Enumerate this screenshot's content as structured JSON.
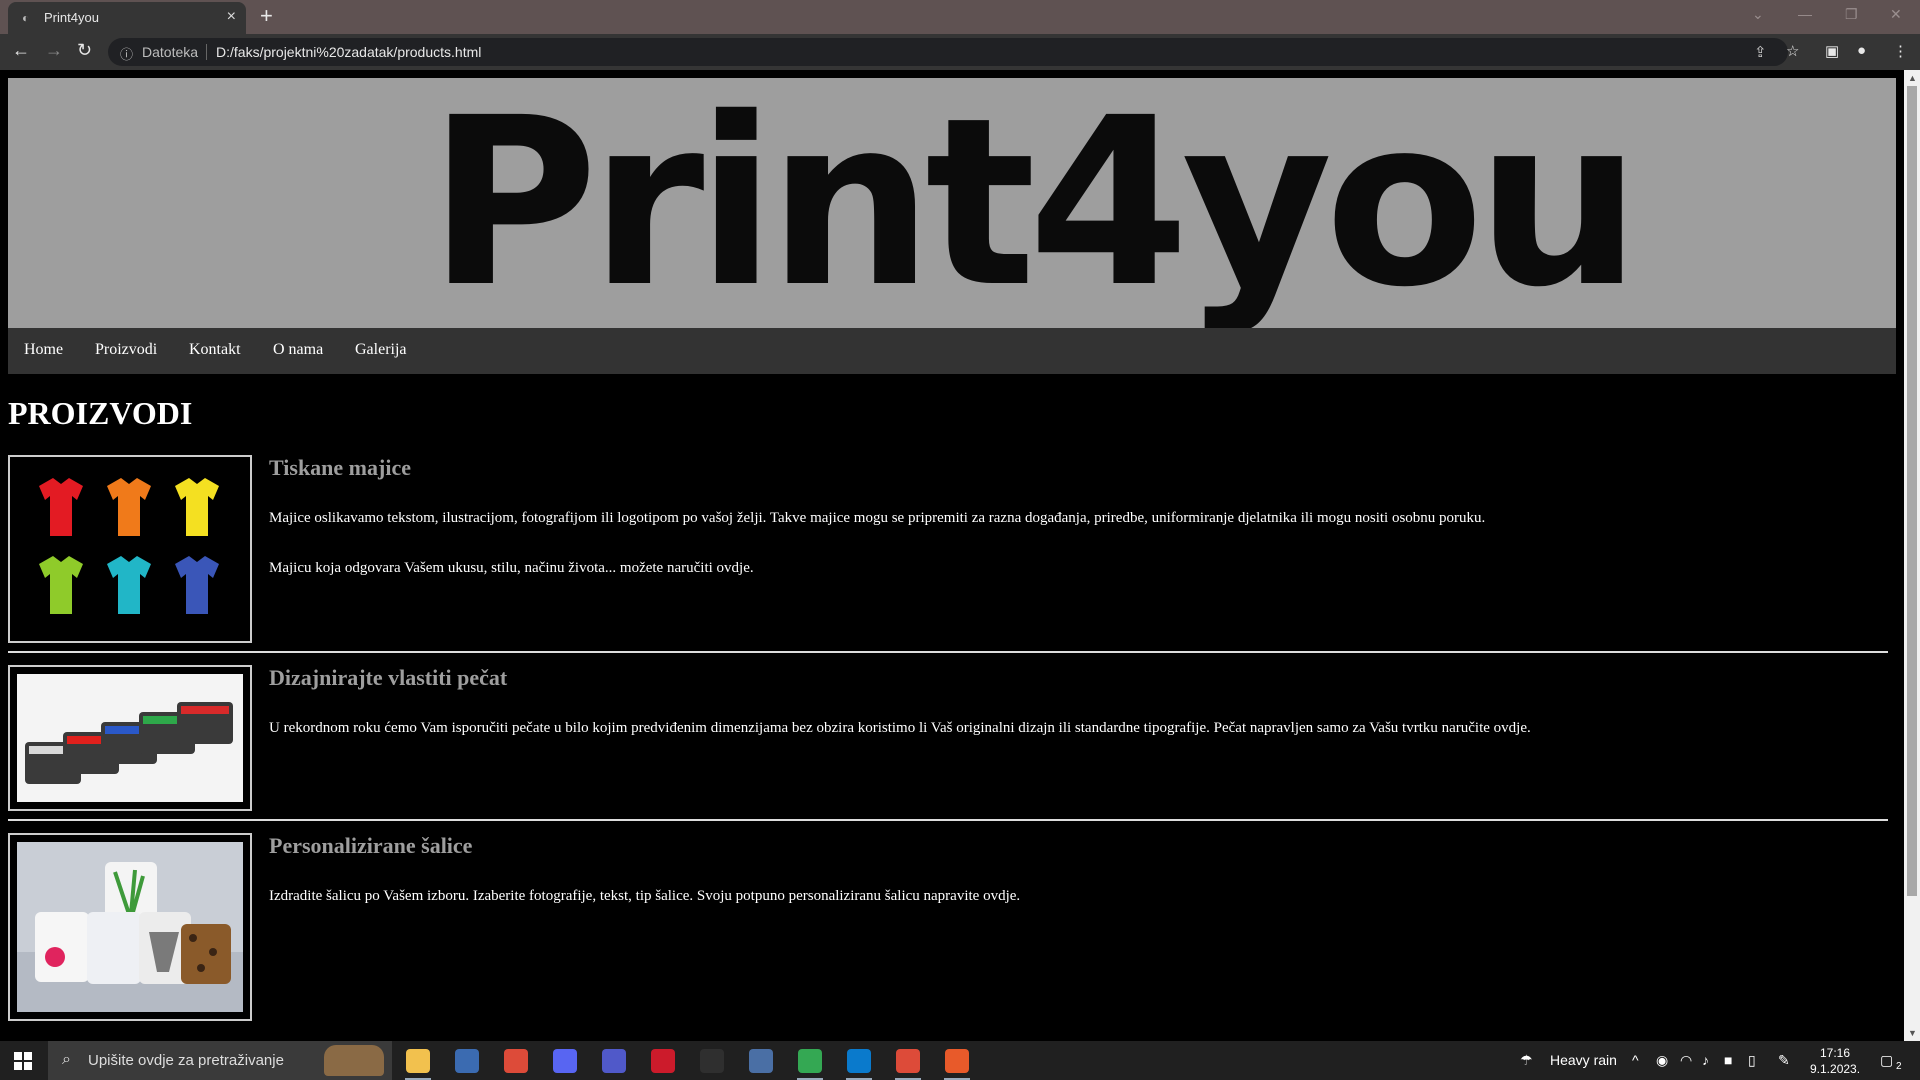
{
  "browser": {
    "tab_title": "Print4you",
    "new_tab": "+",
    "address_scheme": "Datoteka",
    "url": "D:/faks/projektni%20zadatak/products.html"
  },
  "site": {
    "logo": "Print4you",
    "nav": [
      "Home",
      "Proizvodi",
      "Kontakt",
      "O nama",
      "Galerija"
    ],
    "page_title": "PROIZVODI",
    "products": [
      {
        "title": "Tiskane majice",
        "paragraphs": [
          "Majice oslikavamo tekstom, ilustracijom, fotografijom ili logotipom po vašoj želji. Takve majice mogu se pripremiti za razna događanja, priredbe, uniformiranje djelatnika ili mogu nositi osobnu poruku.",
          "Majicu koja odgovara Vašem ukusu, stilu, načinu života... možete naručiti ovdje."
        ]
      },
      {
        "title": "Dizajnirajte vlastiti pečat",
        "paragraphs": [
          "U rekordnom roku ćemo Vam isporučiti pečate u bilo kojim predviđenim dimenzijama bez obzira koristimo li Vaš originalni dizajn ili standardne tipografije. Pečat napravljen samo za Vašu tvrtku naručite ovdje."
        ]
      },
      {
        "title": "Personalizirane šalice",
        "paragraphs": [
          "Izdradite šalicu po Vašem izboru. Izaberite fotografije, tekst, tip šalice. Svoju potpuno personaliziranu šalicu napravite ovdje."
        ]
      }
    ],
    "tshirt_colors": [
      "#e31b23",
      "#f07a1a",
      "#f4e021",
      "#8fcb2a",
      "#21b6c7",
      "#3a56b8"
    ],
    "stamp_colors": [
      "#d8d8d8",
      "#e0201c",
      "#2a58c8",
      "#2ea84a",
      "#d82a2a"
    ]
  },
  "taskbar": {
    "search_placeholder": "Upišite ovdje za pretraživanje",
    "weather": "Heavy rain",
    "time": "17:16",
    "date": "9.1.2023.",
    "notifications": "2",
    "apps": [
      {
        "name": "file-explorer-icon",
        "color": "#f2c14e"
      },
      {
        "name": "bluej-icon",
        "color": "#3b6bb1"
      },
      {
        "name": "chrome-icon",
        "color": "#dd4b39"
      },
      {
        "name": "discord-icon",
        "color": "#5865f2"
      },
      {
        "name": "teams-icon",
        "color": "#5059c9"
      },
      {
        "name": "opera-icon",
        "color": "#cc1b2b"
      },
      {
        "name": "epic-games-icon",
        "color": "#2f2f2f"
      },
      {
        "name": "calculator-icon",
        "color": "#4a6fa5"
      },
      {
        "name": "chrome-profile-icon",
        "color": "#34a853"
      },
      {
        "name": "vscode-icon",
        "color": "#0a7acc"
      },
      {
        "name": "chrome-active-icon",
        "color": "#dd4b39"
      },
      {
        "name": "paint-icon",
        "color": "#e85a2a"
      }
    ]
  }
}
